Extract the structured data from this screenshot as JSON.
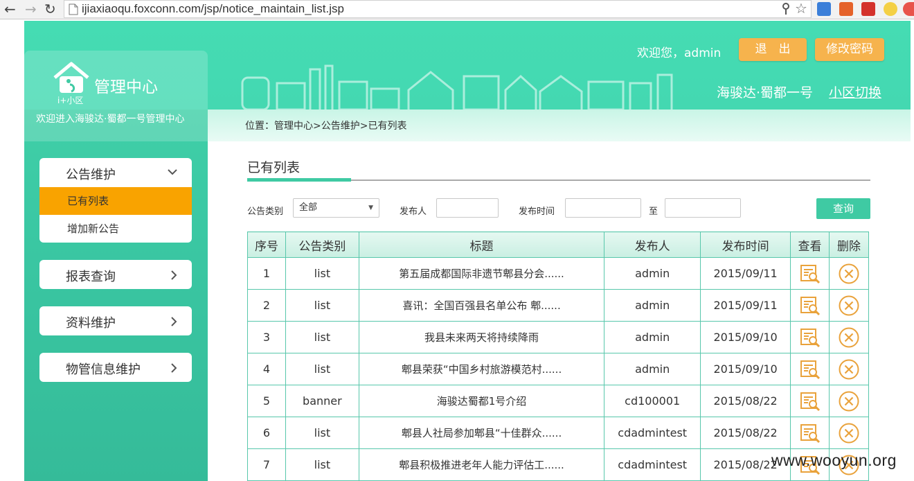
{
  "browser": {
    "url": "ijiaxiaoqu.foxconn.com/jsp/notice_maintain_list.jsp"
  },
  "brand": {
    "logo_text": "i+小区",
    "title": "管理中心",
    "subtitle": "欢迎进入海骏达·蜀都一号管理中心"
  },
  "header": {
    "welcome": "欢迎您，admin",
    "logout_label": "退　出",
    "change_password_label": "修改密码",
    "community_name": "海骏达·蜀都一号",
    "switch_label": "小区切换",
    "breadcrumb": "位置：管理中心>公告维护>已有列表"
  },
  "sidebar": {
    "menus": [
      {
        "label": "公告维护",
        "expanded": true,
        "items": [
          {
            "label": "已有列表",
            "active": true
          },
          {
            "label": "增加新公告",
            "active": false
          }
        ]
      },
      {
        "label": "报表查询",
        "expanded": false
      },
      {
        "label": "资料维护",
        "expanded": false
      },
      {
        "label": "物管信息维护",
        "expanded": false
      }
    ]
  },
  "main": {
    "title": "已有列表",
    "filters": {
      "category_label": "公告类别",
      "category_value": "全部",
      "publisher_label": "发布人",
      "time_label": "发布时间",
      "to_label": "至",
      "query_button": "查询"
    },
    "table": {
      "headers": [
        "序号",
        "公告类别",
        "标题",
        "发布人",
        "发布时间",
        "查看",
        "删除"
      ],
      "rows": [
        {
          "no": "1",
          "category": "list",
          "title": "第五届成都国际非遗节郫县分会......",
          "publisher": "admin",
          "date": "2015/09/11"
        },
        {
          "no": "2",
          "category": "list",
          "title": "喜讯：全国百强县名单公布 郫......",
          "publisher": "admin",
          "date": "2015/09/11"
        },
        {
          "no": "3",
          "category": "list",
          "title": "我县未来两天将持续降雨",
          "publisher": "admin",
          "date": "2015/09/10"
        },
        {
          "no": "4",
          "category": "list",
          "title": "郫县荣获“中国乡村旅游模范村......",
          "publisher": "admin",
          "date": "2015/09/10"
        },
        {
          "no": "5",
          "category": "banner",
          "title": "海骏达蜀都1号介绍",
          "publisher": "cd100001",
          "date": "2015/08/22"
        },
        {
          "no": "6",
          "category": "list",
          "title": "郫县人社局参加郫县“十佳群众......",
          "publisher": "cdadmintest",
          "date": "2015/08/22"
        },
        {
          "no": "7",
          "category": "list",
          "title": "郫县积极推进老年人能力评估工......",
          "publisher": "cdadmintest",
          "date": "2015/08/22"
        }
      ]
    }
  },
  "watermark": "www.wooyun.org",
  "colors": {
    "brand_green": "#3fcaa3",
    "header_green": "#45dcb3",
    "orange_button": "#f6b34d",
    "active_menu": "#f9a300",
    "table_border": "#57c7ab",
    "icon_orange": "#e9a23b"
  },
  "icons": [
    "back-icon",
    "forward-icon",
    "reload-icon",
    "page-icon",
    "key-icon",
    "star-icon",
    "chevron-down-icon",
    "chevron-right-icon",
    "view-icon",
    "delete-icon"
  ]
}
